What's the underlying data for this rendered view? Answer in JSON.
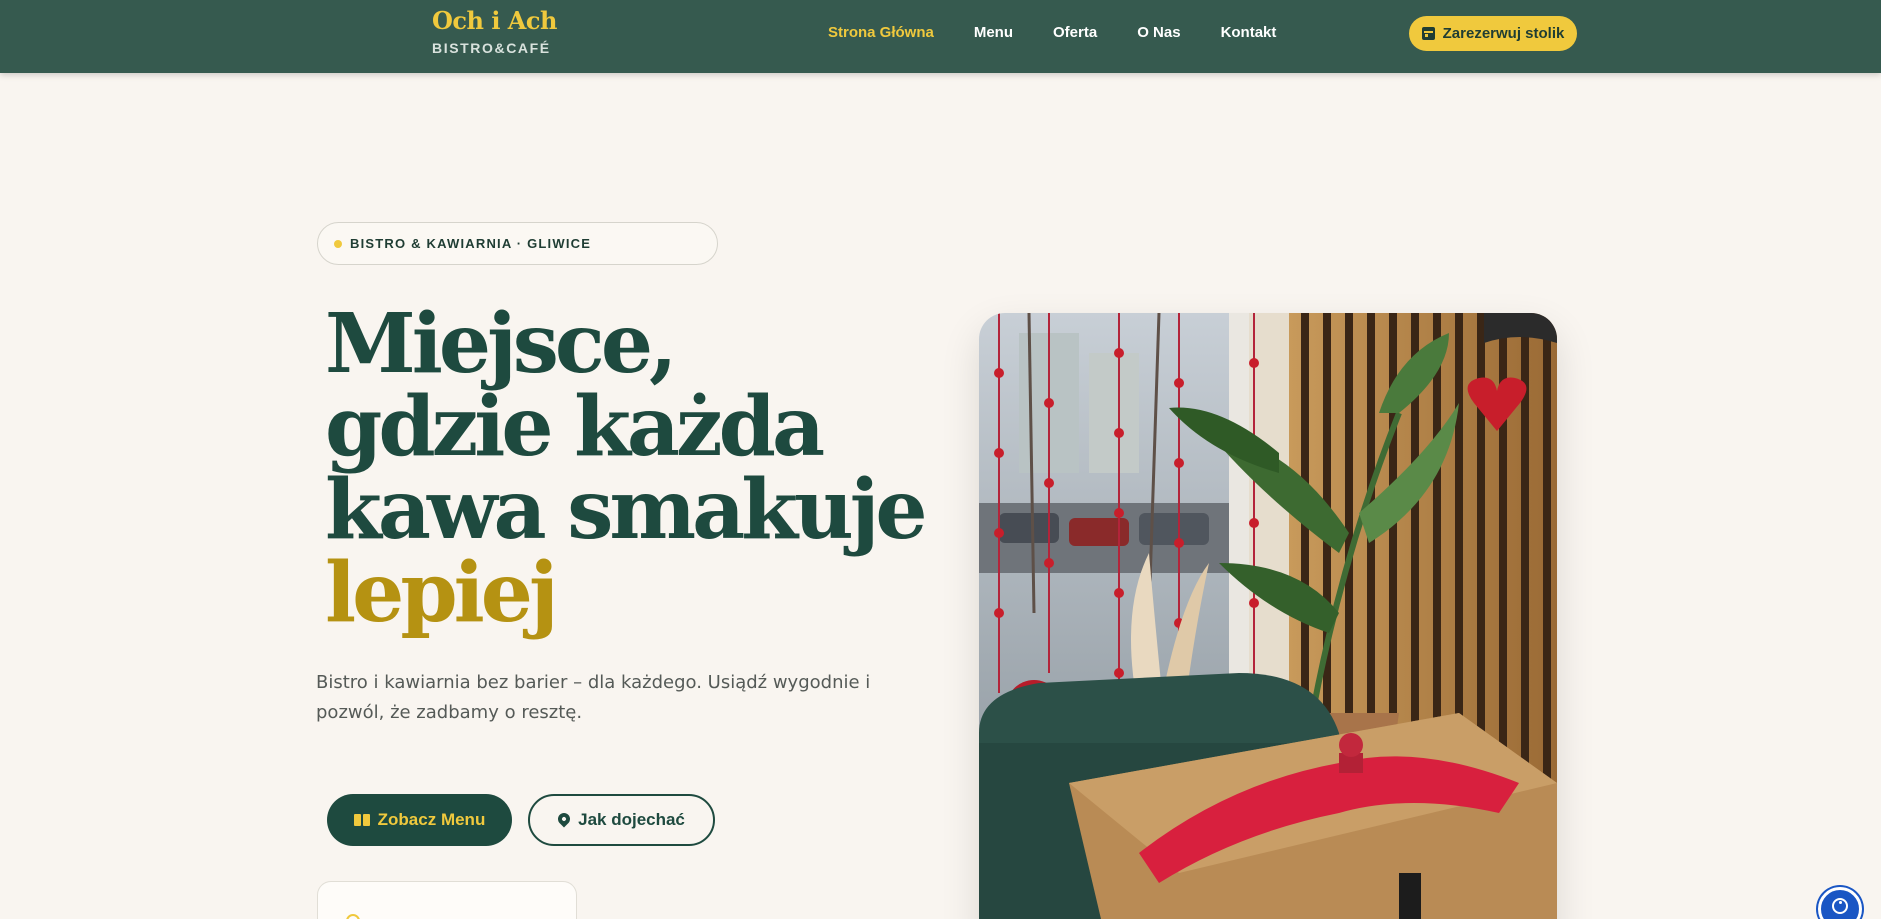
{
  "header": {
    "logo_name": "Och i Ach",
    "logo_tagline": "BISTRO&CAFÉ",
    "nav": [
      {
        "label": "Strona Główna",
        "active": true
      },
      {
        "label": "Menu",
        "active": false
      },
      {
        "label": "Oferta",
        "active": false
      },
      {
        "label": "O Nas",
        "active": false
      },
      {
        "label": "Kontakt",
        "active": false
      }
    ],
    "reserve_label": "Zarezerwuj stolik"
  },
  "hero": {
    "badge": "BISTRO & KAWIARNIA · GLIWICE",
    "title_lines": [
      "Miejsce,",
      "gdzie każda",
      "kawa smakuje"
    ],
    "title_accent": "lepiej",
    "lead": "Bistro i kawiarnia bez barier – dla każdego. Usiądź wygodnie i pozwól, że zadbamy o resztę.",
    "cta_primary": "Zobacz Menu",
    "cta_secondary": "Jak dojechać"
  },
  "icons": {
    "reserve": "calendar-icon",
    "menu": "book-icon",
    "directions": "map-pin-icon",
    "hours": "clock-icon",
    "accessibility": "accessibility-icon"
  },
  "colors": {
    "nav_bg": "#365a4f",
    "brand_yellow": "#f0c93d",
    "dark_green": "#1e4a3f",
    "accent_gold": "#b59212",
    "page_bg": "#f9f5f0"
  }
}
